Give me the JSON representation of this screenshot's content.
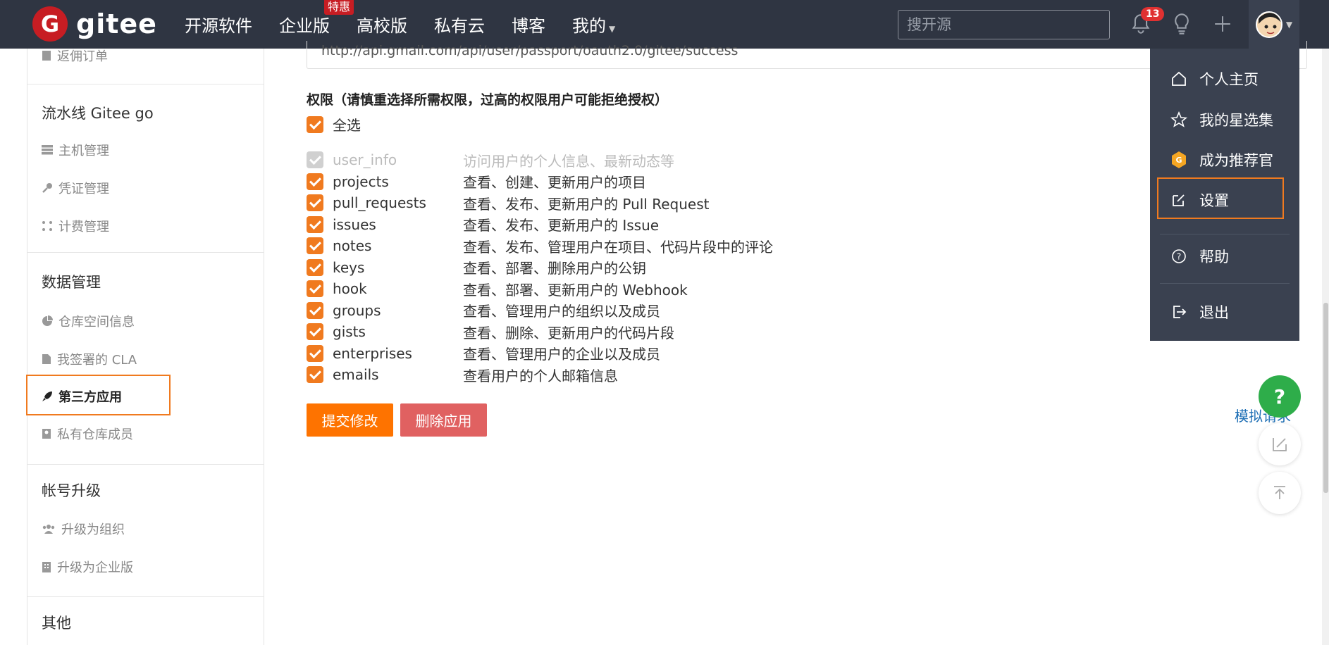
{
  "brand": {
    "logo_letter": "G",
    "logo_text": "gitee"
  },
  "nav": {
    "items": [
      {
        "label": "开源软件"
      },
      {
        "label": "企业版",
        "promo": "特惠"
      },
      {
        "label": "高校版"
      },
      {
        "label": "私有云"
      },
      {
        "label": "博客"
      },
      {
        "label": "我的"
      }
    ],
    "search_placeholder": "搜开源",
    "notification_count": "13"
  },
  "sidebar": {
    "partial_item": "返佣订单",
    "groups": [
      {
        "title": "流水线 Gitee go",
        "items": [
          "主机管理",
          "凭证管理",
          "计费管理"
        ]
      },
      {
        "title": "数据管理",
        "items": [
          "仓库空间信息",
          "我签署的 CLA",
          "第三方应用",
          "私有仓库成员"
        ]
      },
      {
        "title": "帐号升级",
        "items": [
          "升级为组织",
          "升级为企业版"
        ]
      },
      {
        "title": "其他",
        "items": []
      }
    ]
  },
  "main": {
    "callback_url": "http://api.gmail.com/api/user/passport/oauth2.0/gitee/success",
    "perm_title": "权限（请慎重选择所需权限，过高的权限用户可能拒绝授权）",
    "select_all": "全选",
    "permissions": [
      {
        "name": "user_info",
        "desc": "访问用户的个人信息、最新动态等",
        "disabled": true
      },
      {
        "name": "projects",
        "desc": "查看、创建、更新用户的项目"
      },
      {
        "name": "pull_requests",
        "desc": "查看、发布、更新用户的 Pull Request"
      },
      {
        "name": "issues",
        "desc": "查看、发布、更新用户的 Issue"
      },
      {
        "name": "notes",
        "desc": "查看、发布、管理用户在项目、代码片段中的评论"
      },
      {
        "name": "keys",
        "desc": "查看、部署、删除用户的公钥"
      },
      {
        "name": "hook",
        "desc": "查看、部署、更新用户的 Webhook"
      },
      {
        "name": "groups",
        "desc": "查看、管理用户的组织以及成员"
      },
      {
        "name": "gists",
        "desc": "查看、删除、更新用户的代码片段"
      },
      {
        "name": "enterprises",
        "desc": "查看、管理用户的企业以及成员"
      },
      {
        "name": "emails",
        "desc": "查看用户的个人邮箱信息"
      }
    ],
    "submit_label": "提交修改",
    "delete_label": "删除应用",
    "simulate_link": "模拟请求"
  },
  "dropdown": {
    "items": [
      "个人主页",
      "我的星选集",
      "成为推荐官",
      "设置",
      "帮助",
      "退出"
    ]
  },
  "fab": {
    "help": "?"
  },
  "colors": {
    "accent": "#fe7300",
    "danger": "#e06161",
    "nav_bg": "#2f3542",
    "brand_red": "#c71d23",
    "help_green": "#2ead4a"
  }
}
